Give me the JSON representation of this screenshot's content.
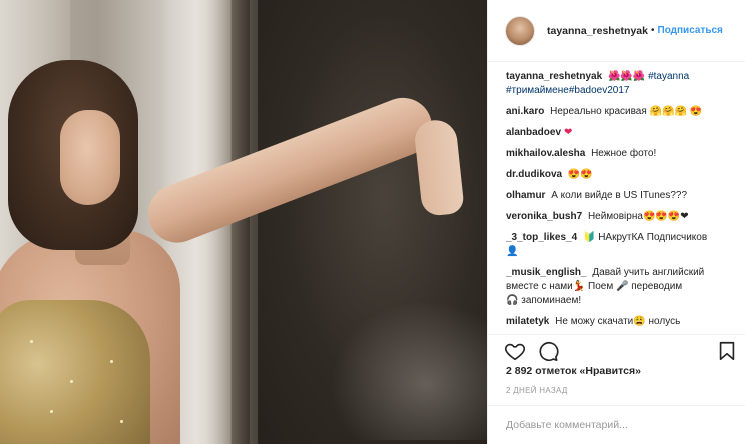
{
  "post": {
    "author": "tayanna_reshetnyak",
    "follow_label": "Подписаться",
    "separator": "•",
    "caption_emoji": "🌺🌺🌺",
    "caption_tags": [
      "#tayanna",
      "#тримаймене#badoev2017"
    ]
  },
  "comments": [
    {
      "user": "ani.karo",
      "text": "Нереально красивая",
      "emoji": "🤗🤗🤗 😍"
    },
    {
      "user": "alanbadoev",
      "text": "",
      "emoji": "❤"
    },
    {
      "user": "mikhailov.alesha",
      "text": "Нежное фото!",
      "emoji": ""
    },
    {
      "user": "dr.dudikova",
      "text": "",
      "emoji": "😍😍"
    },
    {
      "user": "olhamur",
      "text": "А коли вийде в US ITunes???",
      "emoji": ""
    },
    {
      "user": "veronika_bush7",
      "text": "Неймовірна",
      "emoji": "😍😍😍❤"
    },
    {
      "user": "_3_top_likes_4",
      "text": "НАкрутКА Подписчиков",
      "emoji": "🔰",
      "trail": "👤"
    },
    {
      "user": "_musik_english_",
      "text": "Давай учить английский вместе с нами",
      "emoji": "💃",
      "text2": "Поем",
      "emoji2": "🎤",
      "text3": "переводим",
      "emoji3": "🎧",
      "text4": "запоминаем!"
    },
    {
      "user": "milatetyk",
      "text": "Не можу скачати",
      "emoji": "😩",
      "text2": "нолусь"
    }
  ],
  "stats": {
    "likes": "2 892 отметок «Нравится»",
    "time": "2 дней назад"
  },
  "add_comment": {
    "placeholder": "Добавьте комментарий..."
  },
  "icons": [
    "heart-icon",
    "comment-icon",
    "bookmark-icon"
  ]
}
